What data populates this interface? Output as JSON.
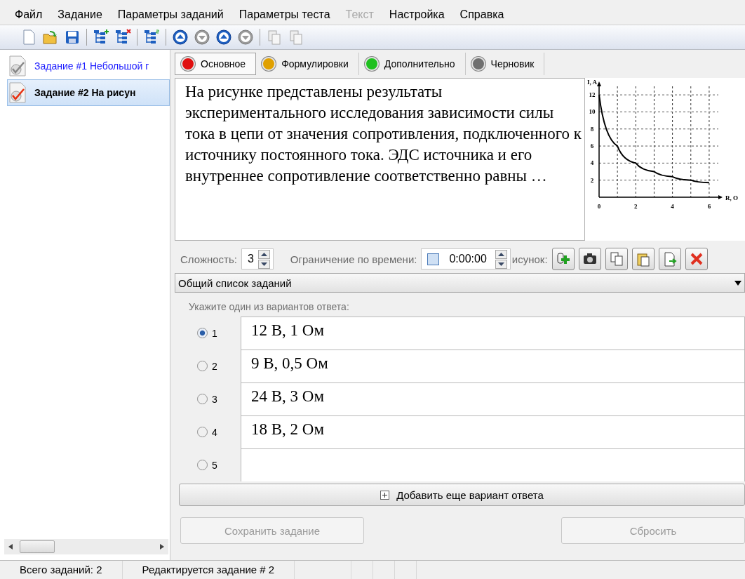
{
  "menu": [
    {
      "label": "Файл",
      "disabled": false
    },
    {
      "label": "Задание",
      "disabled": false
    },
    {
      "label": "Параметры заданий",
      "disabled": false
    },
    {
      "label": "Параметры теста",
      "disabled": false
    },
    {
      "label": "Текст",
      "disabled": true
    },
    {
      "label": "Настройка",
      "disabled": false
    },
    {
      "label": "Справка",
      "disabled": false
    }
  ],
  "toolbar": [
    {
      "kind": "new",
      "disabled": false
    },
    {
      "kind": "open",
      "disabled": false
    },
    {
      "kind": "save",
      "disabled": false
    },
    {
      "kind": "sep"
    },
    {
      "kind": "tree-add",
      "disabled": false
    },
    {
      "kind": "tree-remove",
      "disabled": false
    },
    {
      "kind": "sep"
    },
    {
      "kind": "tree-number",
      "disabled": false
    },
    {
      "kind": "sep"
    },
    {
      "kind": "up",
      "disabled": false
    },
    {
      "kind": "down",
      "disabled": true
    },
    {
      "kind": "top",
      "disabled": false
    },
    {
      "kind": "bottom",
      "disabled": true
    },
    {
      "kind": "sep"
    },
    {
      "kind": "copy",
      "disabled": true
    },
    {
      "kind": "paste",
      "disabled": true
    }
  ],
  "tasks": [
    {
      "title": "Задание #1 Небольшой г",
      "selected": false
    },
    {
      "title": "Задание #2 На рисун",
      "selected": true
    }
  ],
  "tabs": [
    {
      "label": "Основное",
      "color": "#e01010",
      "selected": true
    },
    {
      "label": "Формулировки",
      "color": "#e0a000",
      "selected": false
    },
    {
      "label": "Дополнительно",
      "color": "#20c020",
      "selected": false
    },
    {
      "label": "Черновик",
      "color": "#707070",
      "selected": false
    }
  ],
  "question": {
    "text": "На рисунке представлены результаты экспериментального исследования зависимости силы тока в цепи от значения сопротивления, подключенного к источнику постоянного тока. ЭДС источника и его внутреннее сопротивление соответственно равны …",
    "chart_data": {
      "type": "line",
      "xlabel": "R, О",
      "ylabel": "I, A",
      "x": [
        0,
        1,
        2,
        3,
        4,
        5,
        6
      ],
      "grid": true,
      "series": [
        {
          "color": "#000000",
          "values": [
            12,
            6,
            4,
            3,
            2.4,
            2,
            1.7
          ]
        }
      ],
      "xlim": [
        0,
        6.5
      ],
      "ylim": [
        0,
        13
      ],
      "xticks": [
        0,
        2,
        4,
        6
      ],
      "yticks": [
        2,
        4,
        6,
        8,
        10,
        12
      ]
    }
  },
  "settings": {
    "difficulty_label": "Сложность:",
    "difficulty": "3",
    "time_label": "Ограничение по времени:",
    "time_limit_enabled": false,
    "time": "0:00:00",
    "picture_label": "исунок:"
  },
  "picture_buttons": [
    {
      "kind": "add"
    },
    {
      "kind": "camera"
    },
    {
      "kind": "copy"
    },
    {
      "kind": "paste"
    },
    {
      "kind": "export"
    },
    {
      "kind": "delete"
    }
  ],
  "list_select": {
    "value": "Общий список заданий"
  },
  "answers_hint": "Укажите один из вариантов ответа:",
  "answers": [
    {
      "number": "1",
      "selected": true,
      "text": "12 В, 1 Ом"
    },
    {
      "number": "2",
      "selected": false,
      "text": "9 В, 0,5 Ом"
    },
    {
      "number": "3",
      "selected": false,
      "text": "24 В, 3 Ом"
    },
    {
      "number": "4",
      "selected": false,
      "text": "18 В, 2 Ом"
    },
    {
      "number": "5",
      "selected": false
    }
  ],
  "add_answer": "Добавить еще вариант ответа",
  "buttons": [
    {
      "label": "Сохранить задание",
      "disabled": true
    },
    {
      "label": "Сбросить",
      "disabled": true
    }
  ],
  "status_bar": [
    "Всего заданий: 2",
    "Редактируется задание # 2"
  ]
}
